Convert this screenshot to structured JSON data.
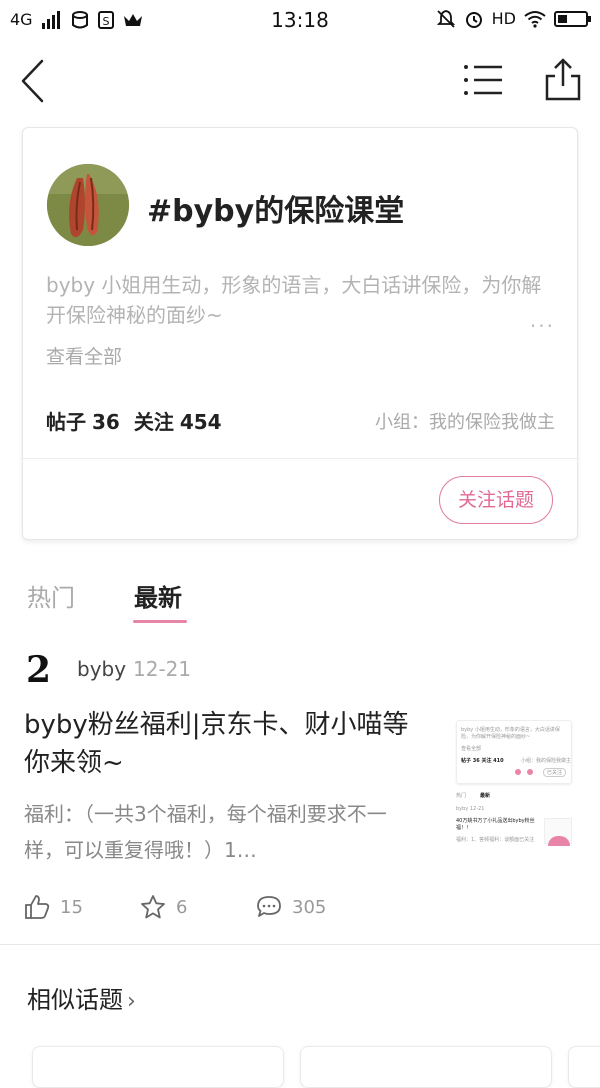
{
  "status_bar": {
    "network": "4G",
    "time": "13:18",
    "hd": "HD",
    "icons": [
      "signal-icon",
      "data-icon",
      "sim-icon",
      "crown-icon",
      "mute-icon",
      "alarm-icon",
      "wifi-icon",
      "battery-icon"
    ]
  },
  "nav": {
    "icons": [
      "back-icon",
      "menu-list-icon",
      "share-icon"
    ]
  },
  "topic": {
    "title": "#byby的保险课堂",
    "description": "byby 小姐用生动，形象的语言，大白话讲保险，为你解开保险神秘的面纱~",
    "more": "···",
    "view_all": "查看全部",
    "posts_label": "帖子",
    "posts_count": "36",
    "followers_label": "关注",
    "followers_count": "454",
    "group": "小组：我的保险我做主",
    "follow_button": "关注话题"
  },
  "tabs": {
    "hot": "热门",
    "latest": "最新",
    "active": "latest"
  },
  "post": {
    "avatar_glyph": "2",
    "author": "byby",
    "date": "12-21",
    "title": "byby粉丝福利|京东卡、财小喵等你来领~",
    "excerpt": "福利：（一共3个福利，每个福利要求不一样，可以重复得哦！）1…",
    "likes": "15",
    "favorites": "6",
    "comments": "305",
    "thumbnail": {
      "desc": "byby 小姐用生动，形象的语言，大白话讲保险，为你解开保险神秘的面纱~",
      "view_all": "查看全部",
      "stats": "帖子 36  关注 410",
      "group": "小组：我的保险我做主",
      "follow": "已关注",
      "tab_hot": "热门",
      "tab_new": "最新",
      "author_line": "byby 12-21",
      "post_title": "40万姚书万了小礼品送出byby粉丝福！！",
      "post_sub": "福利：1、答频福利：谈额面已关注"
    }
  },
  "similar": {
    "title": "相似话题",
    "chevron": "›"
  },
  "colors": {
    "accent": "#e06a96",
    "underline": "#e784a8",
    "muted": "#aaaaaa"
  }
}
